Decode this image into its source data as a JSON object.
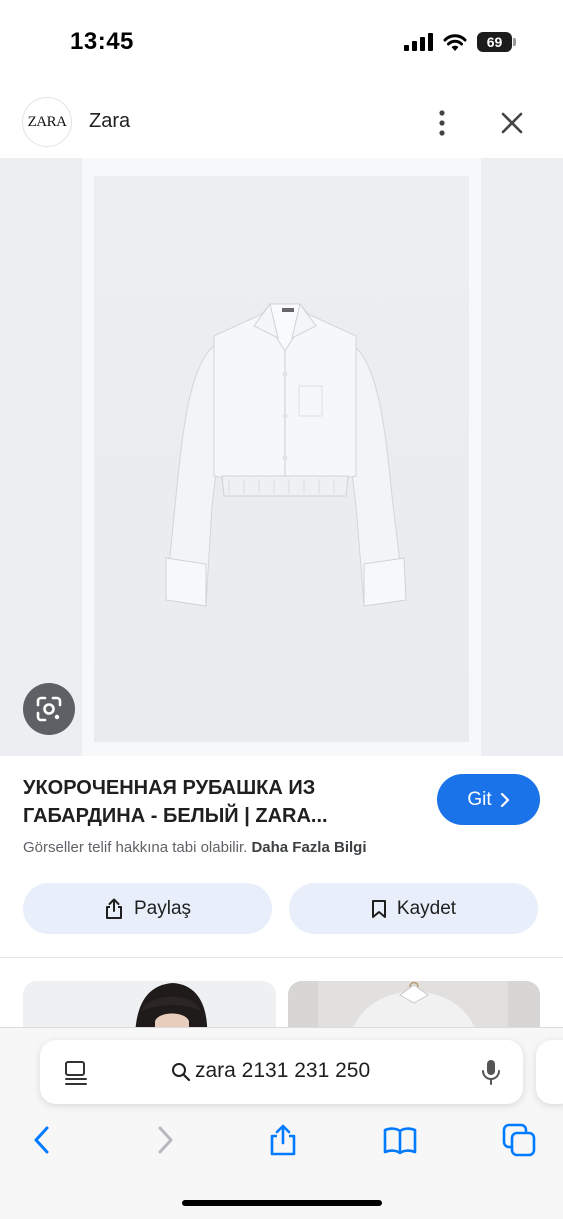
{
  "status_bar": {
    "time": "13:45",
    "battery": "69"
  },
  "header": {
    "logo_text": "ZARA",
    "site_name": "Zara"
  },
  "product": {
    "title": "УКОРОЧЕННАЯ РУБАШКА ИЗ\nГАБАРДИНА - БЕЛЫЙ | ZARA...",
    "visit_label": "Git",
    "copyright_text": "Görseller telif hakkına tabi olabilir.",
    "more_info_label": "Daha Fazla Bilgi",
    "share_label": "Paylaş",
    "save_label": "Kaydet"
  },
  "browser": {
    "search_query": "zara 2131 231 250"
  },
  "colors": {
    "accent": "#1a73e8",
    "chip_bg": "#e8effb",
    "ios_blue": "#007aff"
  },
  "icons": [
    "signal-icon",
    "wifi-icon",
    "battery-icon",
    "more-vert-icon",
    "close-icon",
    "google-lens-icon",
    "share-icon",
    "bookmark-icon",
    "reader-icon",
    "search-icon",
    "mic-icon",
    "back-icon",
    "forward-icon",
    "bookmarks-icon",
    "tabs-icon"
  ]
}
